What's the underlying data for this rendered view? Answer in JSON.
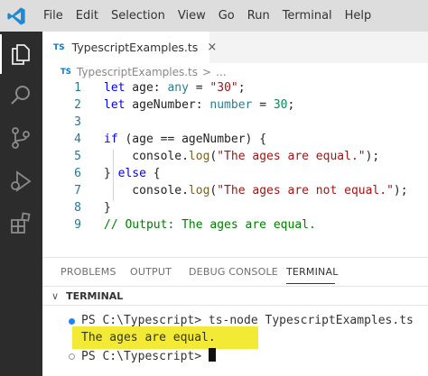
{
  "menu": [
    "File",
    "Edit",
    "Selection",
    "View",
    "Go",
    "Run",
    "Terminal",
    "Help"
  ],
  "activity_icons": [
    "explorer-icon",
    "search-icon",
    "source-control-icon",
    "run-debug-icon",
    "extensions-icon"
  ],
  "tab": {
    "badge": "TS",
    "label": "TypescriptExamples.ts",
    "close": "×"
  },
  "breadcrumb": {
    "badge": "TS",
    "file": "TypescriptExamples.ts",
    "sep": ">",
    "more": "..."
  },
  "code_lines": [
    {
      "number": "1",
      "text": "let age: any = \"30\";"
    },
    {
      "number": "2",
      "text": "let ageNumber: number = 30;"
    },
    {
      "number": "3",
      "text": ""
    },
    {
      "number": "4",
      "text": "if (age == ageNumber) {"
    },
    {
      "number": "5",
      "text": "    console.log(\"The ages are equal.\");"
    },
    {
      "number": "6",
      "text": "} else {"
    },
    {
      "number": "7",
      "text": "    console.log(\"The ages are not equal.\");"
    },
    {
      "number": "8",
      "text": "}"
    },
    {
      "number": "9",
      "text": "// Output: The ages are equal."
    }
  ],
  "panel": {
    "tabs": [
      "PROBLEMS",
      "OUTPUT",
      "DEBUG CONSOLE",
      "TERMINAL"
    ],
    "active_tab": "TERMINAL",
    "terminal_title": "TERMINAL"
  },
  "terminal": {
    "line1": "PS C:\\Typescript> ts-node TypescriptExamples.ts",
    "line2": "The ages are equal.",
    "line3": "PS C:\\Typescript> "
  },
  "colors": {
    "keyword": "#0000ff",
    "type": "#267f99",
    "string": "#a31515",
    "comment": "#008000",
    "function": "#795e26",
    "number": "#098658",
    "highlight": "#f2ea34",
    "ts_badge": "#0a7bca"
  }
}
